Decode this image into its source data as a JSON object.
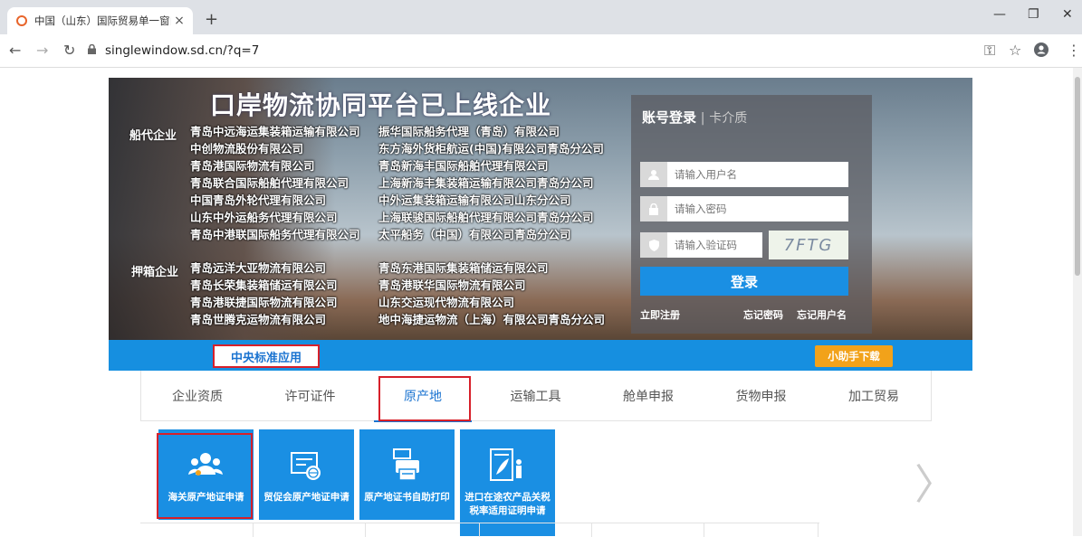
{
  "browser": {
    "tab_title": "中国（山东）国际贸易单一窗口",
    "tab_close": "×",
    "new_tab": "+",
    "url": "singlewindow.sd.cn/?q=7",
    "minimize": "—",
    "restore": "❐",
    "close": "✕"
  },
  "banner": {
    "headline": "口岸物流协同平台已上线企业",
    "shipping_label": "船代企业",
    "shipping_col1": [
      "青岛中远海运集装箱运输有限公司",
      "中创物流股份有限公司",
      "青岛港国际物流有限公司",
      "青岛联合国际船舶代理有限公司",
      "中国青岛外轮代理有限公司",
      "山东中外运船务代理有限公司",
      "青岛中港联国际船务代理有限公司"
    ],
    "shipping_col2": [
      "振华国际船务代理（青岛）有限公司",
      "东方海外货柜航运(中国)有限公司青岛分公司",
      "青岛新海丰国际船舶代理有限公司",
      "上海新海丰集装箱运输有限公司青岛分公司",
      "中外运集装箱运输有限公司山东分公司",
      "上海联骏国际船舶代理有限公司青岛分公司",
      "太平船务（中国）有限公司青岛分公司"
    ],
    "deposit_label": "押箱企业",
    "deposit_col1": [
      "青岛远洋大亚物流有限公司",
      "青岛长荣集装箱储运有限公司",
      "青岛港联捷国际物流有限公司",
      "青岛世腾克运物流有限公司"
    ],
    "deposit_col2": [
      "青岛东港国际集装箱储运有限公司",
      "青岛港联华国际物流有限公司",
      "山东交运现代物流有限公司",
      "地中海捷运物流（上海）有限公司青岛分公司"
    ]
  },
  "login": {
    "tab_account": "账号登录",
    "separator": "|",
    "tab_card": "卡介质",
    "username_placeholder": "请输入用户名",
    "password_placeholder": "请输入密码",
    "captcha_placeholder": "请输入验证码",
    "captcha_text": "7FTG",
    "login_button": "登录",
    "register": "立即注册",
    "forgot_password": "忘记密码",
    "forgot_username": "忘记用户名"
  },
  "bluebar": {
    "central_app": "中央标准应用",
    "helper_download": "小助手下载"
  },
  "categories": [
    "企业资质",
    "许可证件",
    "原产地",
    "运输工具",
    "舱单申报",
    "货物申报",
    "加工贸易"
  ],
  "active_category": "原产地",
  "tiles": [
    {
      "label": "海关原产地证申请",
      "icon": "users-icon"
    },
    {
      "label": "贸促会原产地证申请",
      "icon": "certificate-globe-icon"
    },
    {
      "label": "原产地证书自助打印",
      "icon": "printer-icon"
    },
    {
      "label": "进口在途农产品关税税率适用证明申请",
      "icon": "document-wheat-icon"
    }
  ],
  "nav": {
    "prev": "〈",
    "next": "〉"
  }
}
